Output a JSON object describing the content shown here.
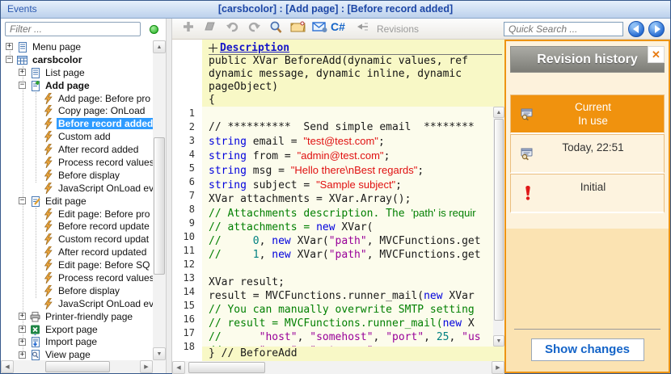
{
  "window": {
    "app_title": "Events",
    "breadcrumb": "[carsbcolor] : [Add page] : [Before record added]"
  },
  "sidebar": {
    "filter_placeholder": "Filter ...",
    "filter_value": "",
    "status_dot": "green",
    "tree": [
      {
        "label": "Menu page",
        "level": 0,
        "expander": "+",
        "icon": "menu-page-icon"
      },
      {
        "label": "carsbcolor",
        "level": 0,
        "expander": "-",
        "icon": "table-icon",
        "bold": true
      },
      {
        "label": "List page",
        "level": 1,
        "expander": "+",
        "icon": "list-page-icon"
      },
      {
        "label": "Add page",
        "level": 1,
        "expander": "-",
        "icon": "add-page-icon",
        "bold": true
      },
      {
        "label": "Add page: Before pro",
        "level": 2,
        "icon": "event-icon"
      },
      {
        "label": "Copy page: OnLoad",
        "level": 2,
        "icon": "event-icon"
      },
      {
        "label": "Before record added",
        "level": 2,
        "icon": "event-icon",
        "selected": true
      },
      {
        "label": "Custom add",
        "level": 2,
        "icon": "event-icon"
      },
      {
        "label": "After record added",
        "level": 2,
        "icon": "event-icon"
      },
      {
        "label": "Process record values",
        "level": 2,
        "icon": "event-icon"
      },
      {
        "label": "Before display",
        "level": 2,
        "icon": "event-icon"
      },
      {
        "label": "JavaScript OnLoad ev",
        "level": 2,
        "icon": "event-icon"
      },
      {
        "label": "Edit page",
        "level": 1,
        "expander": "-",
        "icon": "edit-page-icon"
      },
      {
        "label": "Edit page: Before pro",
        "level": 2,
        "icon": "event-icon"
      },
      {
        "label": "Before record update",
        "level": 2,
        "icon": "event-icon"
      },
      {
        "label": "Custom record updat",
        "level": 2,
        "icon": "event-icon"
      },
      {
        "label": "After record updated",
        "level": 2,
        "icon": "event-icon"
      },
      {
        "label": "Edit page: Before SQ",
        "level": 2,
        "icon": "event-icon"
      },
      {
        "label": "Process record values",
        "level": 2,
        "icon": "event-icon"
      },
      {
        "label": "Before display",
        "level": 2,
        "icon": "event-icon"
      },
      {
        "label": "JavaScript OnLoad ev",
        "level": 2,
        "icon": "event-icon"
      },
      {
        "label": "Printer-friendly page",
        "level": 1,
        "expander": "+",
        "icon": "printer-icon"
      },
      {
        "label": "Export page",
        "level": 1,
        "expander": "+",
        "icon": "export-icon"
      },
      {
        "label": "Import page",
        "level": 1,
        "expander": "+",
        "icon": "import-icon"
      },
      {
        "label": "View page",
        "level": 1,
        "expander": "+",
        "icon": "view-page-icon"
      }
    ]
  },
  "toolbar": {
    "icons": [
      {
        "name": "add-icon",
        "enabled": false
      },
      {
        "name": "eraser-icon",
        "enabled": false
      },
      {
        "name": "undo-icon",
        "enabled": false
      },
      {
        "name": "redo-icon",
        "enabled": false
      },
      {
        "name": "search-icon",
        "enabled": true
      },
      {
        "name": "snippet-folder-icon",
        "enabled": true
      },
      {
        "name": "email-icon",
        "enabled": true
      },
      {
        "name": "csharp-icon",
        "enabled": true
      },
      {
        "name": "revisions-icon",
        "enabled": true
      }
    ],
    "revisions_label": "Revisions",
    "quick_search_placeholder": "Quick Search ..."
  },
  "editor": {
    "description_label": "Description",
    "sig_lines": [
      "public XVar BeforeAdd(dynamic values, ref",
      "dynamic message, dynamic inline, dynamic",
      "pageObject)",
      "{"
    ],
    "footer": "} // BeforeAdd",
    "lines": [
      {
        "n": 1,
        "t": []
      },
      {
        "n": 2,
        "t": [
          {
            "c": "pl",
            "s": "// **********  Send simple email  ********"
          }
        ]
      },
      {
        "n": 3,
        "t": [
          {
            "c": "kw",
            "s": "string"
          },
          {
            "c": "pl",
            "s": " email = "
          },
          {
            "c": "str",
            "s": "\"test@test.com\""
          },
          {
            "c": "pl",
            "s": ";"
          }
        ]
      },
      {
        "n": 4,
        "t": [
          {
            "c": "kw",
            "s": "string"
          },
          {
            "c": "pl",
            "s": " from = "
          },
          {
            "c": "str",
            "s": "\"admin@test.com\""
          },
          {
            "c": "pl",
            "s": ";"
          }
        ]
      },
      {
        "n": 5,
        "t": [
          {
            "c": "kw",
            "s": "string"
          },
          {
            "c": "pl",
            "s": " msg = "
          },
          {
            "c": "str",
            "s": "\"Hello there\\nBest regards\""
          },
          {
            "c": "pl",
            "s": ";"
          }
        ]
      },
      {
        "n": 6,
        "t": [
          {
            "c": "kw",
            "s": "string"
          },
          {
            "c": "pl",
            "s": " subject = "
          },
          {
            "c": "str",
            "s": "\"Sample subject\""
          },
          {
            "c": "pl",
            "s": ";"
          }
        ]
      },
      {
        "n": 7,
        "t": [
          {
            "c": "pl",
            "s": "XVar attachments = XVar.Array();"
          }
        ]
      },
      {
        "n": 8,
        "t": [
          {
            "c": "com",
            "s": "// Attachments description. The "
          },
          {
            "c": "comsans",
            "s": "'path' is requir"
          }
        ]
      },
      {
        "n": 9,
        "t": [
          {
            "c": "com",
            "s": "// attachments = "
          },
          {
            "c": "kw",
            "s": "new"
          },
          {
            "c": "pl",
            "s": " XVar("
          }
        ]
      },
      {
        "n": 10,
        "t": [
          {
            "c": "com",
            "s": "//     "
          },
          {
            "c": "num",
            "s": "0"
          },
          {
            "c": "pl",
            "s": ", "
          },
          {
            "c": "kw",
            "s": "new"
          },
          {
            "c": "pl",
            "s": " XVar("
          },
          {
            "c": "str2",
            "s": "\"path\""
          },
          {
            "c": "pl",
            "s": ", MVCFunctions.get"
          }
        ]
      },
      {
        "n": 11,
        "t": [
          {
            "c": "com",
            "s": "//     "
          },
          {
            "c": "num",
            "s": "1"
          },
          {
            "c": "pl",
            "s": ", "
          },
          {
            "c": "kw",
            "s": "new"
          },
          {
            "c": "pl",
            "s": " XVar("
          },
          {
            "c": "str2",
            "s": "\"path\""
          },
          {
            "c": "pl",
            "s": ", MVCFunctions.get"
          }
        ]
      },
      {
        "n": 12,
        "t": []
      },
      {
        "n": 13,
        "t": [
          {
            "c": "pl",
            "s": "XVar result;"
          }
        ]
      },
      {
        "n": 14,
        "t": [
          {
            "c": "pl",
            "s": "result = MVCFunctions.runner_mail("
          },
          {
            "c": "kw",
            "s": "new"
          },
          {
            "c": "pl",
            "s": " XVar"
          }
        ]
      },
      {
        "n": 15,
        "t": [
          {
            "c": "com",
            "s": "// You can manually overwrite SMTP setting"
          }
        ]
      },
      {
        "n": 16,
        "t": [
          {
            "c": "com",
            "s": "// result = MVCFunctions.runner_mail("
          },
          {
            "c": "kw",
            "s": "new"
          },
          {
            "c": "pl",
            "s": " X"
          }
        ]
      },
      {
        "n": 17,
        "t": [
          {
            "c": "com",
            "s": "//      "
          },
          {
            "c": "str2",
            "s": "\"host\""
          },
          {
            "c": "pl",
            "s": ", "
          },
          {
            "c": "str2",
            "s": "\"somehost\""
          },
          {
            "c": "pl",
            "s": ", "
          },
          {
            "c": "str2",
            "s": "\"port\""
          },
          {
            "c": "pl",
            "s": ", "
          },
          {
            "c": "num",
            "s": "25"
          },
          {
            "c": "pl",
            "s": ", "
          },
          {
            "c": "str2",
            "s": "\"us"
          }
        ]
      },
      {
        "n": 18,
        "t": [
          {
            "c": "com",
            "s": "//      "
          },
          {
            "c": "str2",
            "s": "\"user\""
          },
          {
            "c": "pl",
            "s": ", "
          },
          {
            "c": "str2",
            "s": "\"smtpuser\""
          }
        ]
      }
    ]
  },
  "revision_panel": {
    "title": "Revision history",
    "close_label": "x",
    "items": [
      {
        "line1": "Current",
        "line2": "In use",
        "state": "current",
        "icon": "revision-doc-icon"
      },
      {
        "line1": "Today, 22:51",
        "line2": "",
        "state": "normal",
        "icon": "revision-doc-icon"
      },
      {
        "line1": "Initial",
        "line2": "",
        "state": "initial",
        "icon": "initial-warning-icon"
      }
    ],
    "show_changes_label": "Show changes"
  },
  "colors": {
    "accent_orange": "#F0920E",
    "selection_blue": "#2E9BFF",
    "panel_tan": "#FBE3B2",
    "panel_cream": "#FDF2DC",
    "revision_header_gray": "#8B8B85",
    "code_keyword": "#0000DD",
    "code_string": "#E01010",
    "code_string_alt": "#990099",
    "code_comment": "#007F00",
    "code_number": "#008080",
    "link_blue": "#1464C8",
    "title_blue": "#1D47A6"
  }
}
